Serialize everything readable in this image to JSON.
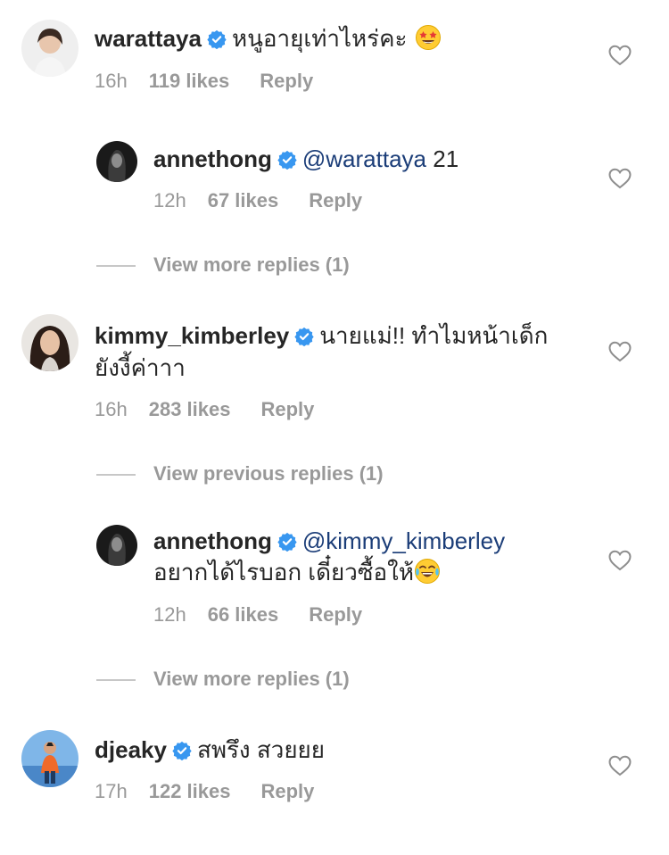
{
  "comments": [
    {
      "user": "warattaya",
      "text": "หนูอายุเท่าไหร่คะ",
      "emoji": "star-struck-emoji",
      "time": "16h",
      "likes": "119 likes",
      "reply": "Reply",
      "replies": [
        {
          "user": "annethong",
          "mention": "@warattaya",
          "text": "21",
          "time": "12h",
          "likes": "67 likes",
          "reply": "Reply"
        }
      ],
      "view_replies": "View more replies (1)"
    },
    {
      "user": "kimmy_kimberley",
      "text_line1": "นายแม่!! ทำไมหน้าเด็ก",
      "text_line2": "ยังงี้ค่าาา",
      "time": "16h",
      "likes": "283 likes",
      "reply": "Reply",
      "view_previous": "View previous replies (1)",
      "replies": [
        {
          "user": "annethong",
          "mention": "@kimmy_kimberley",
          "text": "อยากได้ไรบอก เดี๋ยวซื้อให้",
          "emoji": "tears-of-joy-emoji",
          "time": "12h",
          "likes": "66 likes",
          "reply": "Reply"
        }
      ],
      "view_replies": "View more replies (1)"
    },
    {
      "user": "djeaky",
      "text": "สพรึง สวยยย",
      "time": "17h",
      "likes": "122 likes",
      "reply": "Reply"
    }
  ],
  "colors": {
    "verified": "#3897f0",
    "mention": "#1b3d78",
    "meta": "#999999",
    "text": "#262626"
  },
  "icons": [
    "verified-badge-icon",
    "heart-outline-icon"
  ]
}
